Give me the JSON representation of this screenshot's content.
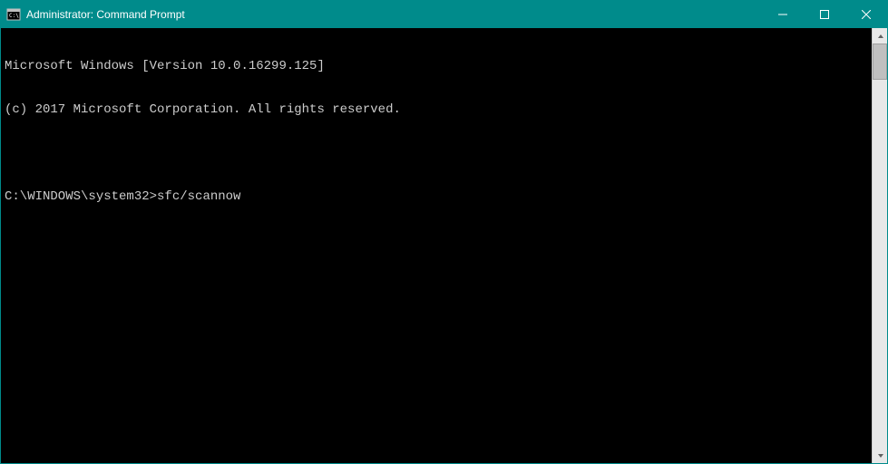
{
  "titlebar": {
    "title": "Administrator: Command Prompt"
  },
  "terminal": {
    "line1": "Microsoft Windows [Version 10.0.16299.125]",
    "line2": "(c) 2017 Microsoft Corporation. All rights reserved.",
    "blank": "",
    "prompt": "C:\\WINDOWS\\system32>",
    "command": "sfc/scannow"
  }
}
